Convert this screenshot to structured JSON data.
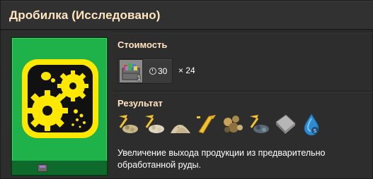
{
  "window": {
    "title": "Дробилка (Исследовано)"
  },
  "tech_card": {
    "icon": "crusher-gears-icon",
    "bg_color": "#1fb14a",
    "icon_bg": "#ffe800"
  },
  "cost": {
    "label": "Стоимость",
    "science_pack_icon": "science-pack-icon",
    "science_pack_count": "1",
    "time": "30",
    "multiplier": "× 24"
  },
  "result": {
    "label": "Результат",
    "effects": [
      {
        "icon": "unlock-recipe-icon"
      },
      {
        "icon": "unlock-recipe-icon"
      },
      {
        "icon": "sand-recipe-icon"
      },
      {
        "icon": "unlock-recipe-icon"
      },
      {
        "icon": "crushed-ore-icon"
      },
      {
        "icon": "unlock-recipe-icon"
      },
      {
        "icon": "stone-tablet-icon"
      },
      {
        "icon": "water-droplet-icon"
      }
    ]
  },
  "description": "Увеличение выхода продукции из предварительно обработанной руды."
}
